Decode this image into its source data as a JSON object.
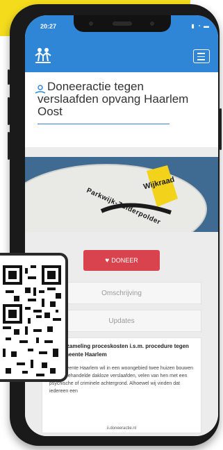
{
  "statusbar": {
    "time": "20:27",
    "icons": "signal-wifi-battery"
  },
  "navbar": {
    "logo": "logo-icon",
    "menu": "hamburger-icon"
  },
  "campaign": {
    "title": "Doneeractie tegen verslaafden opvang Haarlem Oost",
    "icon": "donation-icon"
  },
  "hero": {
    "sign_top": "Wijkraad",
    "sign_bottom": "Parkwijk-Zuiderpolder"
  },
  "actions": {
    "donate_label": "DONEER",
    "heart": "heart-icon"
  },
  "tabs": [
    {
      "label": "Omschrijving"
    },
    {
      "label": "Updates"
    }
  ],
  "update": {
    "title": "Geldinzameling proceskosten i.s.m. procedure tegen de gemeente Haarlem",
    "body": "De gemeente Haarlem wil in een woongebied twee huizen bouwen voor uitbehandelde dakloze verslaafden, velen van hen met een psychische of criminele achtergrond. Alhoewel wij vinden dat iedereen een"
  },
  "footer": {
    "site": "ii.doneeractie.nl"
  },
  "colors": {
    "brand": "#2f86d6",
    "donate": "#d9434e",
    "yellow": "#f4dc1c"
  }
}
